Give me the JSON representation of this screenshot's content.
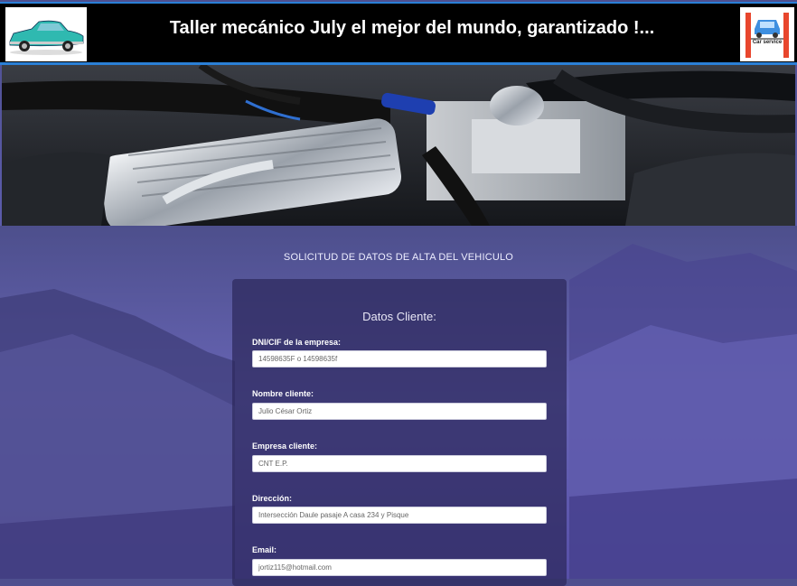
{
  "header": {
    "title": "Taller mecánico July el mejor del mundo, garantizado !...",
    "logo_left_icon": "classic-car-icon",
    "logo_right_icon": "car-service-lift-icon",
    "logo_right_text": "Car service",
    "accent_color": "#2a7fd6"
  },
  "form": {
    "section_title": "SOLICITUD DE DATOS DE ALTA DEL VEHICULO",
    "panel_title": "Datos Cliente:",
    "fields": [
      {
        "label": "DNI/CIF de la empresa:",
        "placeholder": "14598635F o 14598635f"
      },
      {
        "label": "Nombre cliente:",
        "placeholder": "Julio César Ortiz"
      },
      {
        "label": "Empresa cliente:",
        "placeholder": "CNT E.P."
      },
      {
        "label": "Dirección:",
        "placeholder": "Intersección Daule pasaje A casa 234 y Pisque"
      },
      {
        "label": "Email:",
        "placeholder": "jortiz115@hotmail.com"
      }
    ]
  }
}
